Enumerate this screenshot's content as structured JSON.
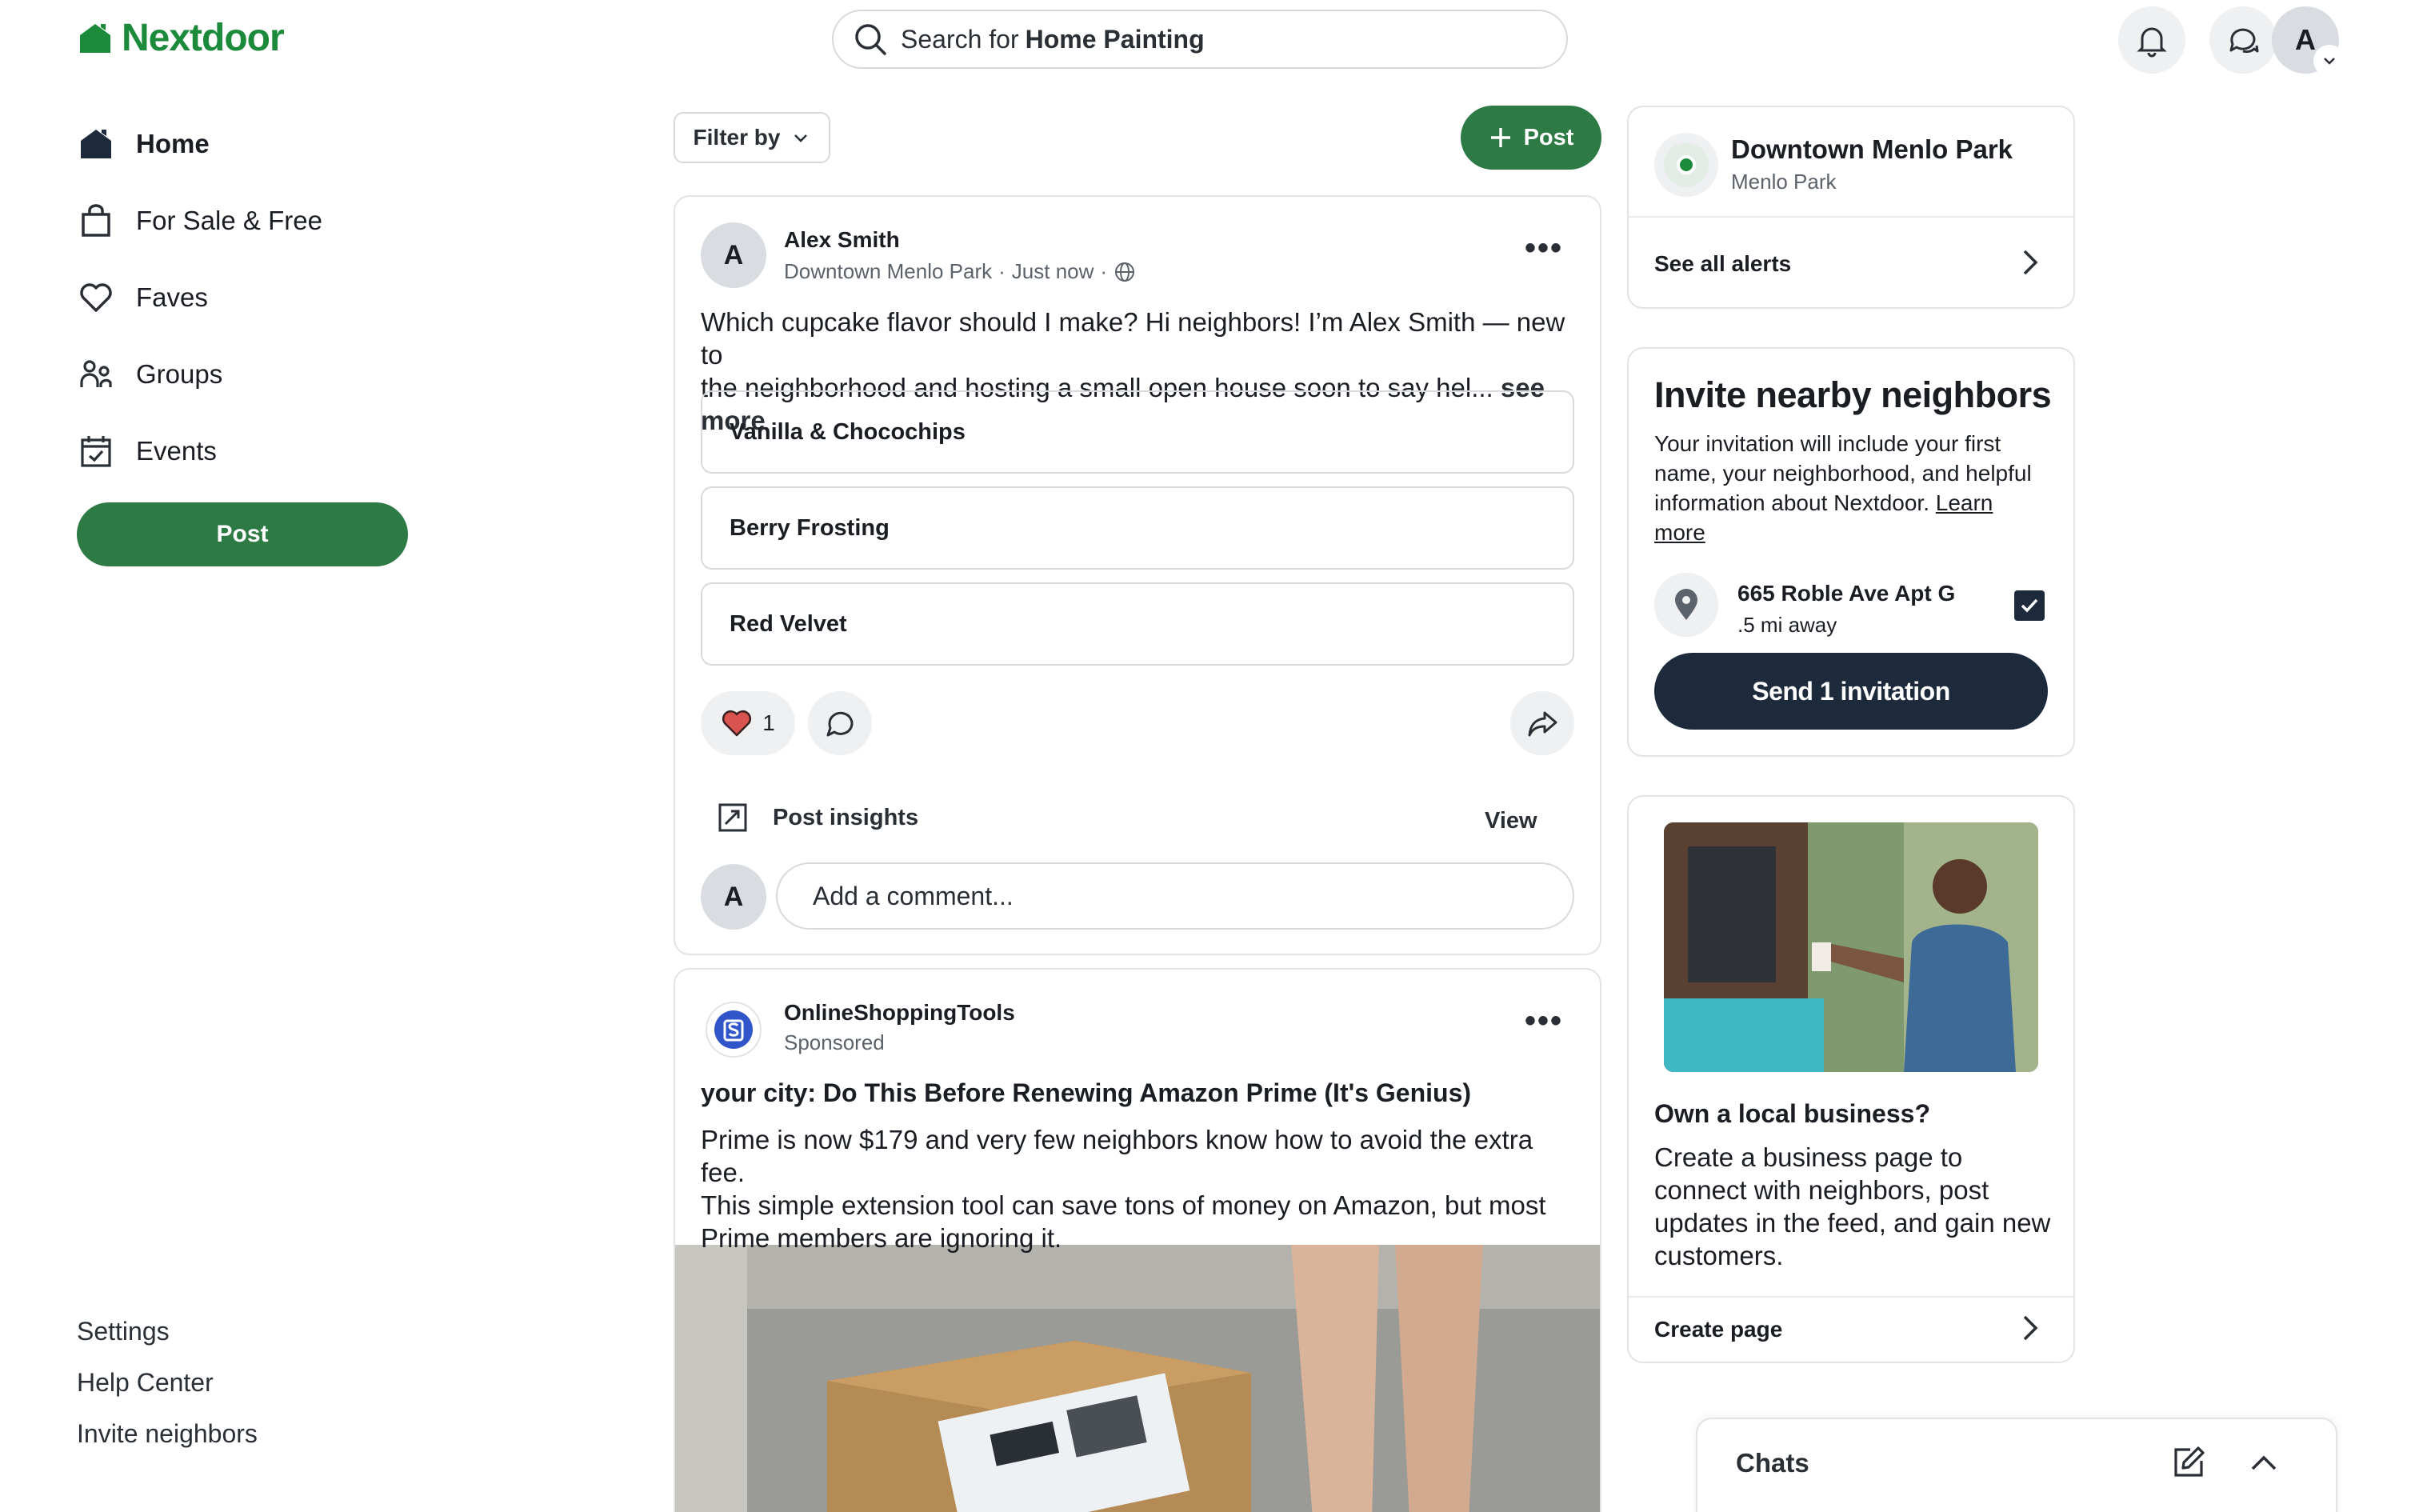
{
  "header": {
    "logo_text": "Nextdoor",
    "search_prefix": "Search for",
    "search_term": "Home Painting",
    "avatar_initial": "A"
  },
  "sidebar": {
    "items": [
      {
        "label": "Home",
        "icon": "home-icon",
        "active": true
      },
      {
        "label": "For Sale & Free",
        "icon": "shopping-bag-icon",
        "active": false
      },
      {
        "label": "Faves",
        "icon": "heart-icon",
        "active": false
      },
      {
        "label": "Groups",
        "icon": "groups-icon",
        "active": false
      },
      {
        "label": "Events",
        "icon": "calendar-icon",
        "active": false
      }
    ],
    "post_label": "Post",
    "footer_links": [
      "Settings",
      "Help Center",
      "Invite neighbors"
    ]
  },
  "feed": {
    "filter_label": "Filter by",
    "post_label": "Post",
    "post": {
      "avatar_initial": "A",
      "author": "Alex Smith",
      "neighborhood": "Downtown Menlo Park",
      "time": "Just now",
      "body_line1": "Which cupcake flavor should I make? Hi neighbors! I’m Alex Smith — new to",
      "body_line2": "the neighborhood and hosting a small open house soon to say hel...",
      "see_more": "see more",
      "poll_options": [
        "Vanilla & Chocochips",
        "Berry Frosting",
        "Red Velvet"
      ],
      "reaction_count": "1",
      "insights_label": "Post insights",
      "view_label": "View",
      "comment_avatar": "A",
      "comment_placeholder": "Add a comment..."
    },
    "ad": {
      "advertiser": "OnlineShoppingTools",
      "sponsored": "Sponsored",
      "title": "your city: Do This Before Renewing Amazon Prime (It's Genius)",
      "body_line1": "Prime is now $179 and very few neighbors know how to avoid the extra fee.",
      "body_line2": "This simple extension tool can save tons of money on Amazon, but most",
      "body_line3": "Prime members are ignoring it."
    }
  },
  "right": {
    "location": {
      "title": "Downtown Menlo Park",
      "subtitle": "Menlo Park",
      "alerts_link": "See all alerts"
    },
    "invite": {
      "heading": "Invite nearby neighbors",
      "body_line1": "Your invitation will include your first",
      "body_line2": "name, your neighborhood, and helpful",
      "body_line3": "information about Nextdoor.",
      "learn": "Learn",
      "more": "more",
      "address": "665 Roble Ave Apt G",
      "distance": ".5 mi away",
      "send_label": "Send 1 invitation"
    },
    "business": {
      "heading": "Own a local business?",
      "body_line1": "Create a business page to",
      "body_line2": "connect with neighbors, post",
      "body_line3": "updates in the feed, and gain new",
      "body_line4": "customers.",
      "create_link": "Create page"
    },
    "chats_label": "Chats"
  },
  "colors": {
    "brand_green": "#1b8a3a",
    "button_green": "#2d7a45",
    "navy": "#1d2a3b",
    "border": "#e1e3e6"
  }
}
